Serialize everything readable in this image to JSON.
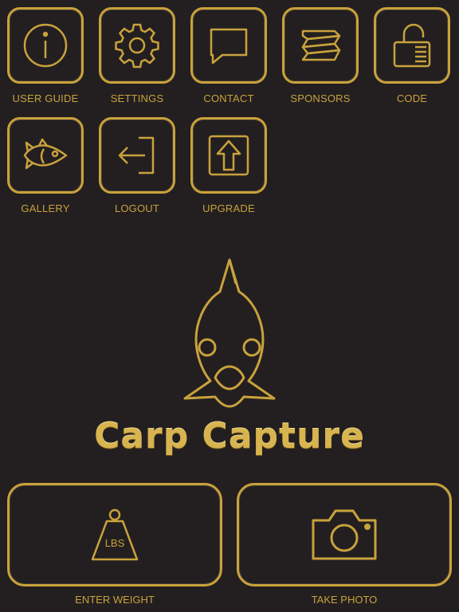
{
  "menu": {
    "items": [
      {
        "id": "user-guide",
        "label": "USER GUIDE"
      },
      {
        "id": "settings",
        "label": "SETTINGS"
      },
      {
        "id": "contact",
        "label": "CONTACT"
      },
      {
        "id": "sponsors",
        "label": "SPONSORS"
      },
      {
        "id": "code",
        "label": "CODE"
      },
      {
        "id": "gallery",
        "label": "GALLERY"
      },
      {
        "id": "logout",
        "label": "LOGOUT"
      },
      {
        "id": "upgrade",
        "label": "UPGRADE"
      }
    ]
  },
  "brand": {
    "title": "Carp Capture"
  },
  "actions": {
    "enter_weight": {
      "label": "ENTER WEIGHT",
      "badge": "LBS"
    },
    "take_photo": {
      "label": "TAKE PHOTO"
    }
  },
  "colors": {
    "background": "#231f20",
    "gold": "#c9a23c"
  }
}
